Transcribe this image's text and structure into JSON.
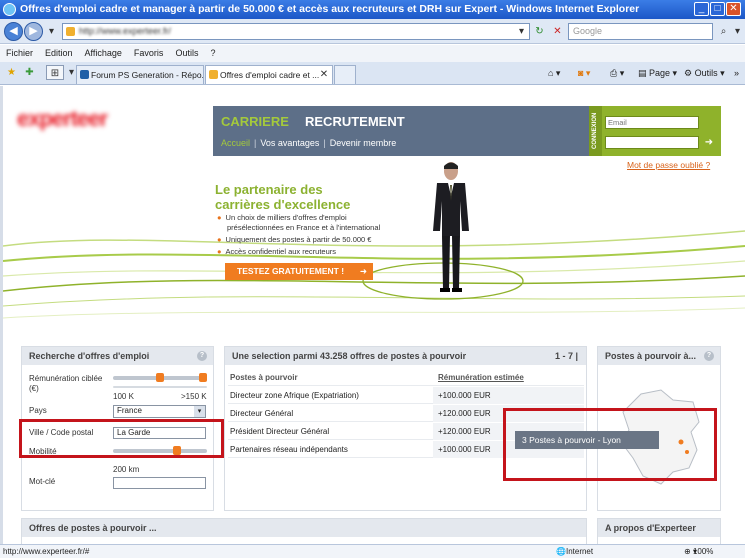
{
  "window": {
    "title": "Offres d'emploi cadre et manager à partir de 50.000 € et accès aux recruteurs et DRH sur Expert - Windows Internet Explorer"
  },
  "address": {
    "url": "http://www.experteer.fr/",
    "search_placeholder": "Google"
  },
  "menu": [
    "Fichier",
    "Edition",
    "Affichage",
    "Favoris",
    "Outils",
    "?"
  ],
  "tabs": [
    {
      "label": "Forum PS Generation - Répo..."
    },
    {
      "label": "Offres d'emploi cadre et ..."
    }
  ],
  "toolbar": {
    "page": "Page",
    "tools": "Outils"
  },
  "site": {
    "logo": "experteer",
    "header": {
      "carriere": "CARRIERE",
      "recrutement": "RECRUTEMENT",
      "nav": [
        "Accueil",
        "Vos avantages",
        "Devenir membre"
      ]
    },
    "connexion": {
      "vertical": "CONNEXION",
      "email_placeholder": "Email",
      "forgot": "Mot de passe oublié ?"
    },
    "hero": {
      "tagline_1": "Le partenaire des",
      "tagline_2": "carrières d'excellence",
      "bullets": [
        "Un choix de milliers d'offres d'emploi",
        "présélectionnées en France et à l'international",
        "Uniquement des postes à partir de 50.000 €",
        "Accès confidentiel aux recruteurs"
      ],
      "cta": "TESTEZ GRATUITEMENT !"
    },
    "search": {
      "title": "Recherche d'offres d'emploi",
      "remun_label_1": "Rémunération ciblée",
      "remun_label_2": "(€)",
      "remun_min": "100 K",
      "remun_max": ">150 K",
      "remun_range_pct": [
        0.5,
        1.0
      ],
      "pays_label": "Pays",
      "pays_value": "France",
      "ville_label": "Ville / Code postal",
      "ville_value": "La Garde",
      "mobilite_label": "Mobilité",
      "mobilite_value": "200 km",
      "mobilite_pct": 0.7,
      "motcle_label": "Mot-clé"
    },
    "offers": {
      "title": "Une selection parmi 43.258 offres de postes à pourvoir",
      "pager": "1 - 7 |",
      "col_poste": "Postes à pourvoir",
      "col_remun": "Rémunération estimée",
      "rows": [
        {
          "poste": "Directeur zone Afrique (Expatriation)",
          "remun": "+100.000 EUR"
        },
        {
          "poste": "Directeur Général",
          "remun": "+120.000 EUR"
        },
        {
          "poste": "Président Directeur Général",
          "remun": "+120.000 EUR"
        },
        {
          "poste": "Partenaires réseau indépendants",
          "remun": "+100.000 EUR"
        }
      ]
    },
    "map": {
      "title": "Postes à pourvoir à...",
      "tooltip": "3 Postes à pourvoir - Lyon"
    },
    "bottom": {
      "left": "Offres de postes à pourvoir ...",
      "right": "A propos d'Experteer"
    }
  },
  "status": {
    "url": "http://www.experteer.fr/#",
    "zone": "Internet",
    "zoom": "100%"
  },
  "colors": {
    "green": "#8cb231",
    "orange": "#f07c20",
    "header": "#5d6f88",
    "highlight": "#c4141b"
  }
}
